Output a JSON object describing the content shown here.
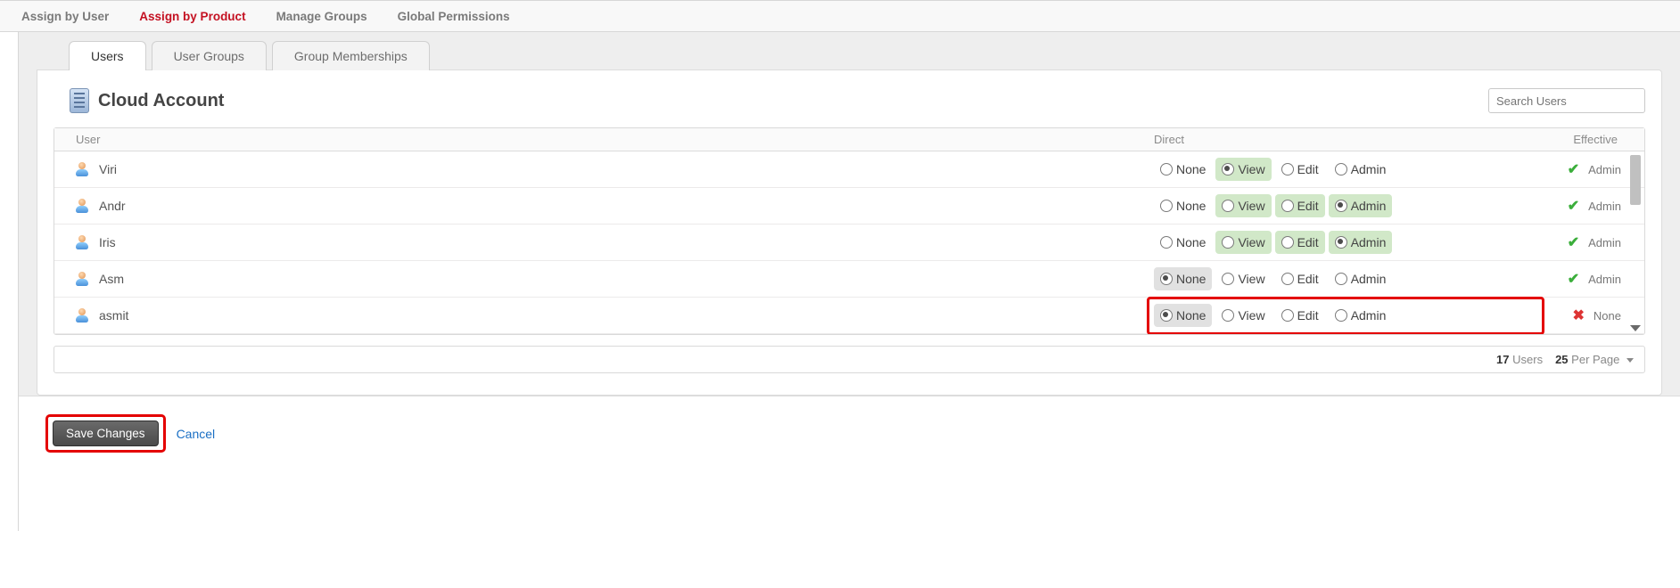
{
  "topnav": {
    "items": [
      {
        "label": "Assign by User",
        "active": false
      },
      {
        "label": "Assign by Product",
        "active": true
      },
      {
        "label": "Manage Groups",
        "active": false
      },
      {
        "label": "Global Permissions",
        "active": false
      }
    ]
  },
  "tabs": [
    {
      "label": "Users",
      "active": true
    },
    {
      "label": "User Groups",
      "active": false
    },
    {
      "label": "Group Memberships",
      "active": false
    }
  ],
  "page": {
    "title": "Cloud Account",
    "search_placeholder": "Search Users"
  },
  "columns": {
    "user": "User",
    "direct": "Direct",
    "effective": "Effective"
  },
  "perm_labels": {
    "none": "None",
    "view": "View",
    "edit": "Edit",
    "admin": "Admin"
  },
  "rows": [
    {
      "name": "Viri",
      "direct_selected": "view",
      "highlights": [
        "view"
      ],
      "effective": "Admin",
      "effective_ok": true,
      "redbox": false
    },
    {
      "name": "Andr",
      "direct_selected": "admin",
      "highlights": [
        "view",
        "edit",
        "admin"
      ],
      "effective": "Admin",
      "effective_ok": true,
      "redbox": false
    },
    {
      "name": "Iris",
      "direct_selected": "admin",
      "highlights": [
        "view",
        "edit",
        "admin"
      ],
      "effective": "Admin",
      "effective_ok": true,
      "redbox": false
    },
    {
      "name": "Asm",
      "direct_selected": "none",
      "highlights": [
        "none-grey"
      ],
      "effective": "Admin",
      "effective_ok": true,
      "redbox": false
    },
    {
      "name": "asmit",
      "direct_selected": "none",
      "highlights": [
        "none-grey"
      ],
      "effective": "None",
      "effective_ok": false,
      "redbox": true
    }
  ],
  "footer": {
    "count": "17",
    "count_label": "Users",
    "per_page": "25",
    "per_page_label": "Per Page"
  },
  "actions": {
    "save": "Save Changes",
    "cancel": "Cancel"
  }
}
